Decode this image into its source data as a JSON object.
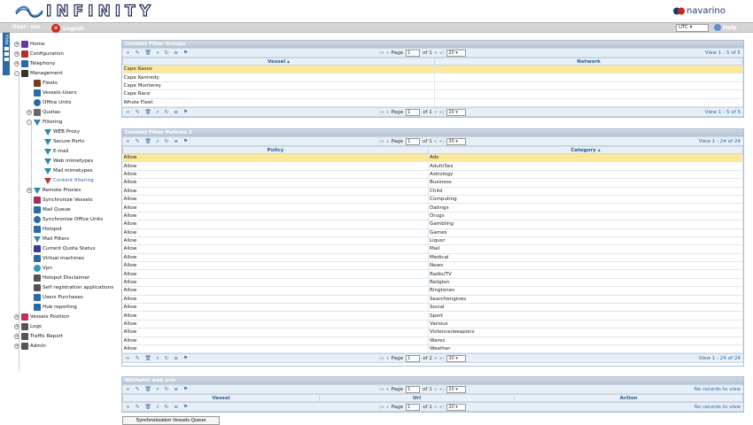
{
  "header": {
    "app_name": "INFINITY",
    "brand": "navarino",
    "brand_color": "#1a3a70"
  },
  "userbar": {
    "user": "User: xxx",
    "logout": "Logout",
    "timezone": "UTC",
    "help": "Help"
  },
  "hidebar": {
    "label": "Hide"
  },
  "tree": [
    {
      "label": "Home",
      "icon": "home-icon",
      "level": 0,
      "expand": "+"
    },
    {
      "label": "Configuration",
      "icon": "wrench-icon",
      "level": 0,
      "expand": "+"
    },
    {
      "label": "Telephony",
      "icon": "phone-icon",
      "level": 0,
      "expand": "+"
    },
    {
      "label": "Management",
      "icon": "people-icon",
      "level": 0,
      "expand": "-"
    },
    {
      "label": "Fleets",
      "icon": "ships-icon",
      "level": 1
    },
    {
      "label": "Vessels-Users",
      "icon": "users-icon",
      "level": 1
    },
    {
      "label": "Office Units",
      "icon": "globe-icon",
      "level": 1
    },
    {
      "label": "Quotas",
      "icon": "gear-icon",
      "level": 1,
      "expand": "+"
    },
    {
      "label": "Filtering",
      "icon": "filter-icon",
      "level": 1,
      "expand": "-"
    },
    {
      "label": "WEB Proxy",
      "icon": "filter-icon",
      "level": 2
    },
    {
      "label": "Secure Ports",
      "icon": "filter-icon",
      "level": 2
    },
    {
      "label": "E-mail",
      "icon": "filter-icon",
      "level": 2
    },
    {
      "label": "Web mimetypes",
      "icon": "filter-icon",
      "level": 2
    },
    {
      "label": "Mail mimetypes",
      "icon": "filter-icon",
      "level": 2
    },
    {
      "label": "Content filtering",
      "icon": "filter-block-icon",
      "level": 2,
      "active": true
    },
    {
      "label": "Remote Proxies",
      "icon": "filter-icon",
      "level": 1,
      "expand": "+"
    },
    {
      "label": "Synchronize Vessels",
      "icon": "sync-icon",
      "level": 1
    },
    {
      "label": "Mail Queue",
      "icon": "mail-icon",
      "level": 1
    },
    {
      "label": "Synchronize Office Units",
      "icon": "globe-icon",
      "level": 1
    },
    {
      "label": "Hotspot",
      "icon": "wifi-icon",
      "level": 1
    },
    {
      "label": "Mail Filters",
      "icon": "filter-icon",
      "level": 1
    },
    {
      "label": "Current Quota Status",
      "icon": "chart-icon",
      "level": 1
    },
    {
      "label": "Virtual machines",
      "icon": "server-icon",
      "level": 1
    },
    {
      "label": "Vpn",
      "icon": "cloud-icon",
      "level": 1
    },
    {
      "label": "Hotspot Disclaimer",
      "icon": "doc-icon",
      "level": 1
    },
    {
      "label": "Self registration applications",
      "icon": "doc-icon",
      "level": 1
    },
    {
      "label": "Users Purchases",
      "icon": "cart-icon",
      "level": 1
    },
    {
      "label": "Hub reporting",
      "icon": "report-icon",
      "level": 1
    },
    {
      "label": "Vessels Position",
      "icon": "pin-icon",
      "level": 0,
      "expand": "+"
    },
    {
      "label": "Logs",
      "icon": "doc-icon",
      "level": 0,
      "expand": "+"
    },
    {
      "label": "Traffic Report",
      "icon": "bar-icon",
      "level": 0,
      "expand": "+"
    },
    {
      "label": "Admin",
      "icon": "admin-icon",
      "level": 0,
      "expand": "+"
    }
  ],
  "groups": {
    "title": "Content Filter Groups",
    "columns": [
      "Vessel ▴",
      "Network"
    ],
    "rows": [
      "Cape Kasos",
      "Cape Kennedy",
      "Cape Monterey",
      "Cape Race",
      "Whole Fleet"
    ],
    "page": "1",
    "of": "of 1",
    "page_label": "Page",
    "per_page": "20",
    "info": "View 1 - 5 of 5"
  },
  "policies": {
    "title": "Content Filter Policies 2",
    "columns": [
      "Policy",
      "Category ▴"
    ],
    "rows": [
      [
        "Allow",
        "Ads"
      ],
      [
        "Allow",
        "Adult/Sex"
      ],
      [
        "Allow",
        "Astrology"
      ],
      [
        "Allow",
        "Business"
      ],
      [
        "Allow",
        "Child"
      ],
      [
        "Allow",
        "Computing"
      ],
      [
        "Allow",
        "Datings"
      ],
      [
        "Allow",
        "Drugs"
      ],
      [
        "Allow",
        "Gambling"
      ],
      [
        "Allow",
        "Games"
      ],
      [
        "Allow",
        "Liquor"
      ],
      [
        "Allow",
        "Mail"
      ],
      [
        "Allow",
        "Medical"
      ],
      [
        "Allow",
        "News"
      ],
      [
        "Allow",
        "Radio/TV"
      ],
      [
        "Allow",
        "Religion"
      ],
      [
        "Allow",
        "Ringtones"
      ],
      [
        "Allow",
        "Searchengines"
      ],
      [
        "Allow",
        "Social"
      ],
      [
        "Allow",
        "Sport"
      ],
      [
        "Allow",
        "Various"
      ],
      [
        "Allow",
        "Violence/weapons"
      ],
      [
        "Allow",
        "Warez"
      ],
      [
        "Allow",
        "Weather"
      ]
    ],
    "page": "1",
    "of": "of 1",
    "page_label": "Page",
    "per_page": "30",
    "info": "View 1 - 24 of 24"
  },
  "whitelist": {
    "title": "Whitelist web urls",
    "columns": [
      "Vessel",
      "Url",
      "Action"
    ],
    "page": "1",
    "of": "of 1",
    "page_label": "Page",
    "per_page": "20",
    "info": "No records to view"
  },
  "sync_button": "Synchronization Vessels Queue"
}
